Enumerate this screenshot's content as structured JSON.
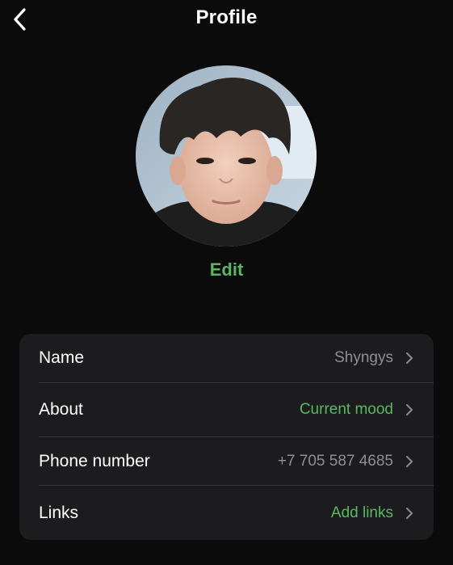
{
  "header": {
    "title": "Profile",
    "back_icon": "chevron-left-icon"
  },
  "avatar": {
    "edit_label": "Edit"
  },
  "colors": {
    "background": "#0b0b0b",
    "card": "#1c1c1e",
    "accent_green": "#58b862",
    "secondary_text": "#8e8e93"
  },
  "rows": [
    {
      "label": "Name",
      "value": "Shyngys"
    },
    {
      "label": "About",
      "value": "Current mood"
    },
    {
      "label": "Phone number",
      "value": "+7 705 587 4685"
    },
    {
      "label": "Links",
      "value": "Add links"
    }
  ]
}
